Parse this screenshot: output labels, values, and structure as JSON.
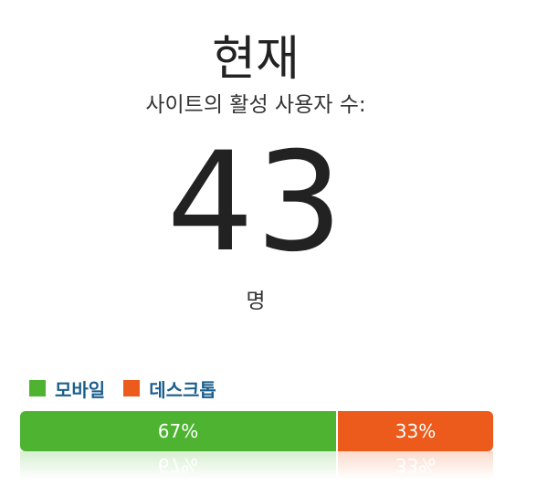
{
  "header": {
    "title": "현재",
    "subtitle": "사이트의 활성 사용자 수:"
  },
  "active_users": {
    "count": "43",
    "unit": "명"
  },
  "legend": [
    {
      "label": "모바일",
      "color": "#4db331"
    },
    {
      "label": "데스크톱",
      "color": "#ec5a1c"
    }
  ],
  "breakdown": {
    "mobile": {
      "percent_label": "67%",
      "share": 0.67,
      "color": "#4db331"
    },
    "desktop": {
      "percent_label": "33%",
      "share": 0.33,
      "color": "#ec5a1c"
    }
  }
}
